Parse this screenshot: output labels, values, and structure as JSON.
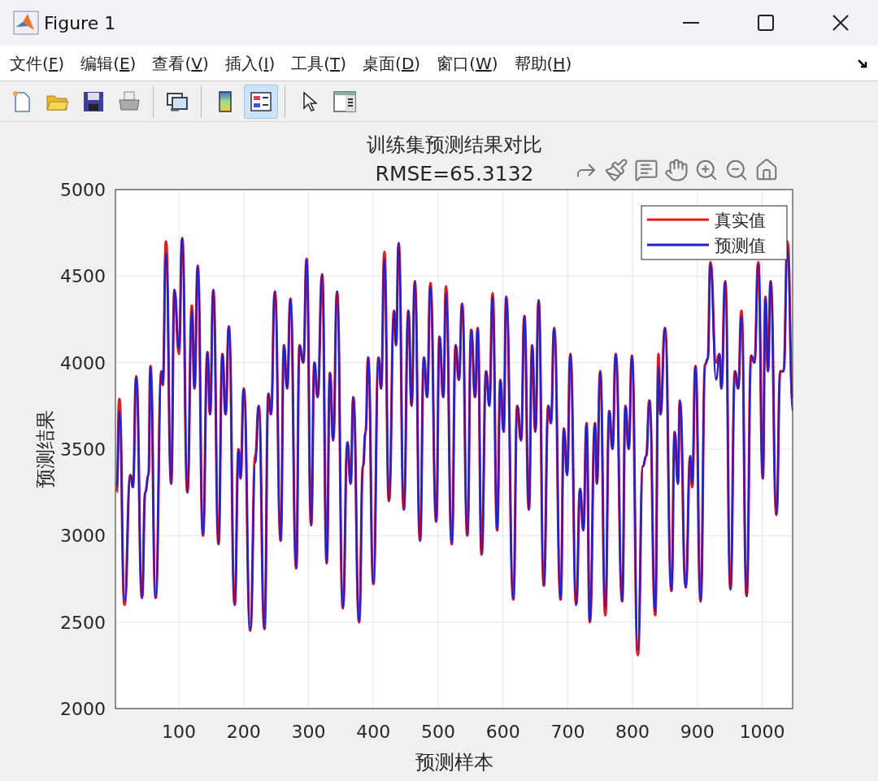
{
  "window": {
    "title": "Figure 1"
  },
  "menu": [
    {
      "label": "文件(F)"
    },
    {
      "label": "编辑(E)"
    },
    {
      "label": "查看(V)"
    },
    {
      "label": "插入(I)"
    },
    {
      "label": "工具(T)"
    },
    {
      "label": "桌面(D)"
    },
    {
      "label": "窗口(W)"
    },
    {
      "label": "帮助(H)"
    }
  ],
  "toolbar": [
    {
      "kind": "new",
      "selected": false
    },
    {
      "kind": "open",
      "selected": false
    },
    {
      "kind": "save",
      "selected": false
    },
    {
      "kind": "print",
      "selected": false
    },
    {
      "kind": "sep"
    },
    {
      "kind": "link",
      "selected": false
    },
    {
      "kind": "sep"
    },
    {
      "kind": "colorbar",
      "selected": false
    },
    {
      "kind": "legend",
      "selected": true
    },
    {
      "kind": "sep"
    },
    {
      "kind": "pointer",
      "selected": false
    },
    {
      "kind": "panel",
      "selected": false
    }
  ],
  "figure": {
    "chart_data": {
      "type": "line",
      "grid": true,
      "legend": true,
      "title": [
        "训练集预测结果对比",
        "RMSE=65.3132"
      ],
      "xlabel": "预测样本",
      "ylabel": "预测结果",
      "xlim": [
        2,
        1047
      ],
      "ylim": [
        2000,
        5000
      ],
      "xticks": [
        100,
        200,
        300,
        400,
        500,
        600,
        700,
        800,
        900,
        1000
      ],
      "yticks": [
        2000,
        2500,
        3000,
        3500,
        4000,
        4500,
        5000
      ],
      "x": [
        4,
        8,
        16,
        25,
        29,
        34,
        43,
        48,
        53,
        56,
        64,
        73,
        75,
        80,
        88,
        93,
        100,
        105,
        113,
        120,
        124,
        129,
        137,
        144,
        148,
        153,
        161,
        167,
        172,
        177,
        186,
        192,
        195,
        200,
        210,
        218,
        223,
        232,
        238,
        242,
        248,
        257,
        262,
        267,
        272,
        281,
        286,
        292,
        297,
        304,
        309,
        314,
        321,
        328,
        333,
        338,
        344,
        353,
        360,
        365,
        369,
        378,
        384,
        388,
        392,
        400,
        408,
        412,
        417,
        424,
        432,
        435,
        439,
        447,
        454,
        459,
        464,
        472,
        478,
        483,
        488,
        497,
        502,
        508,
        512,
        521,
        527,
        532,
        537,
        545,
        551,
        557,
        561,
        567,
        574,
        579,
        584,
        591,
        596,
        601,
        605,
        616,
        622,
        628,
        633,
        640,
        645,
        650,
        655,
        663,
        670,
        674,
        679,
        689,
        694,
        699,
        704,
        713,
        719,
        724,
        729,
        734,
        742,
        745,
        750,
        758,
        764,
        769,
        774,
        784,
        789,
        794,
        799,
        808,
        816,
        821,
        826,
        835,
        840,
        843,
        850,
        860,
        865,
        870,
        873,
        882,
        889,
        892,
        897,
        905,
        912,
        916,
        920,
        929,
        934,
        937,
        943,
        951,
        958,
        963,
        968,
        976,
        983,
        988,
        994,
        1001,
        1005,
        1009,
        1013,
        1022,
        1028,
        1033,
        1039,
        1047
      ],
      "series": [
        {
          "name": "真实值",
          "color": "#e41a1c",
          "values": [
            3250,
            3790,
            2600,
            3350,
            3280,
            3920,
            2640,
            3250,
            3350,
            3980,
            2640,
            3950,
            3870,
            4700,
            3300,
            4420,
            4050,
            4720,
            3250,
            4330,
            3850,
            4560,
            3000,
            4060,
            3700,
            4420,
            2950,
            4050,
            3700,
            4210,
            2600,
            3500,
            3330,
            3850,
            2450,
            3470,
            3750,
            2460,
            3820,
            3700,
            4410,
            2970,
            4100,
            3850,
            4370,
            2810,
            4100,
            4000,
            4600,
            3060,
            4000,
            3800,
            4510,
            2840,
            3940,
            3550,
            4410,
            2580,
            3540,
            3300,
            3800,
            2500,
            3400,
            3600,
            4030,
            2720,
            4030,
            3850,
            4640,
            3200,
            4300,
            4100,
            4690,
            3150,
            4300,
            3750,
            4470,
            2970,
            4030,
            3800,
            4460,
            3080,
            4150,
            3800,
            4440,
            2950,
            4100,
            3900,
            4340,
            3000,
            4190,
            3800,
            4200,
            2890,
            3950,
            3750,
            4400,
            3030,
            3900,
            3600,
            4380,
            2630,
            3750,
            3550,
            4270,
            3150,
            4100,
            3600,
            4360,
            2710,
            3750,
            3650,
            4200,
            2630,
            3620,
            3350,
            4050,
            2600,
            3270,
            3030,
            3650,
            2500,
            3650,
            3300,
            3950,
            2540,
            3720,
            3500,
            4050,
            2620,
            3750,
            3500,
            4040,
            2310,
            3400,
            3460,
            3780,
            2540,
            4050,
            3700,
            4200,
            2680,
            3600,
            3300,
            3780,
            2700,
            3460,
            3280,
            3980,
            2620,
            3990,
            4020,
            4580,
            4000,
            4050,
            3850,
            4470,
            2690,
            3950,
            3850,
            4300,
            2650,
            4040,
            4000,
            4580,
            3330,
            4380,
            3950,
            4470,
            3120,
            3950,
            3950,
            4700,
            3800
          ]
        },
        {
          "name": "预测值",
          "color": "#1f1fd6",
          "values": [
            3280,
            3720,
            2620,
            3350,
            3280,
            3920,
            2640,
            3250,
            3350,
            3980,
            2640,
            3950,
            3870,
            4630,
            3300,
            4420,
            4080,
            4720,
            3250,
            4300,
            3850,
            4560,
            3000,
            4060,
            3700,
            4420,
            2950,
            4050,
            3700,
            4210,
            2600,
            3500,
            3330,
            3850,
            2450,
            3420,
            3750,
            2460,
            3820,
            3700,
            4410,
            2970,
            4100,
            3850,
            4370,
            2810,
            4100,
            4000,
            4600,
            3060,
            4000,
            3800,
            4510,
            2840,
            3940,
            3550,
            4410,
            2580,
            3540,
            3300,
            3800,
            2500,
            3400,
            3600,
            4030,
            2720,
            4030,
            3850,
            4600,
            3200,
            4300,
            4100,
            4690,
            3150,
            4300,
            3750,
            4470,
            2970,
            4030,
            3800,
            4440,
            3080,
            4150,
            3800,
            4400,
            2950,
            4100,
            3900,
            4340,
            3000,
            4190,
            3800,
            4200,
            2890,
            3950,
            3750,
            4380,
            3030,
            3900,
            3600,
            4380,
            2630,
            3750,
            3550,
            4270,
            3150,
            4100,
            3600,
            4360,
            2710,
            3750,
            3650,
            4200,
            2630,
            3620,
            3350,
            4050,
            2600,
            3270,
            3030,
            3650,
            2500,
            3650,
            3300,
            3950,
            2580,
            3720,
            3500,
            4050,
            2620,
            3750,
            3500,
            4040,
            2340,
            3400,
            3460,
            3780,
            2560,
            3980,
            3700,
            4200,
            2680,
            3600,
            3300,
            3780,
            2700,
            3460,
            3300,
            3980,
            2620,
            3990,
            4020,
            4570,
            3900,
            4050,
            3850,
            4470,
            2690,
            3950,
            3850,
            4270,
            2650,
            4040,
            4000,
            4570,
            3330,
            4380,
            3950,
            4470,
            3120,
            3950,
            3950,
            4660,
            3720
          ]
        }
      ]
    }
  },
  "axes_toolbar": [
    {
      "kind": "export"
    },
    {
      "kind": "brush"
    },
    {
      "kind": "datatip"
    },
    {
      "kind": "pan"
    },
    {
      "kind": "zoomin"
    },
    {
      "kind": "zoomout"
    },
    {
      "kind": "home"
    }
  ]
}
